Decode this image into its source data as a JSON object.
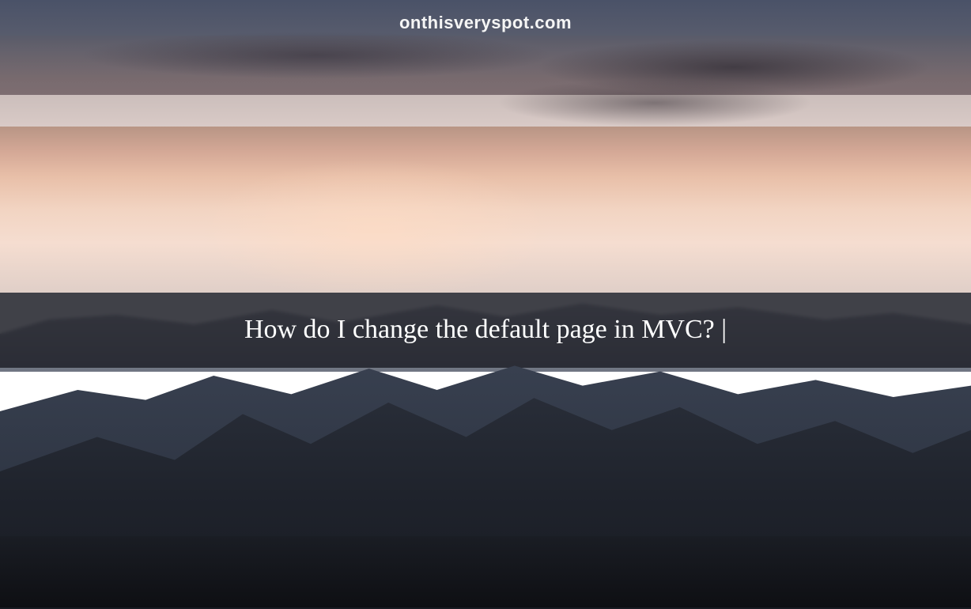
{
  "header": {
    "website_url": "onthisveryspot.com"
  },
  "content": {
    "title": "How do I change the default page in MVC? |"
  }
}
